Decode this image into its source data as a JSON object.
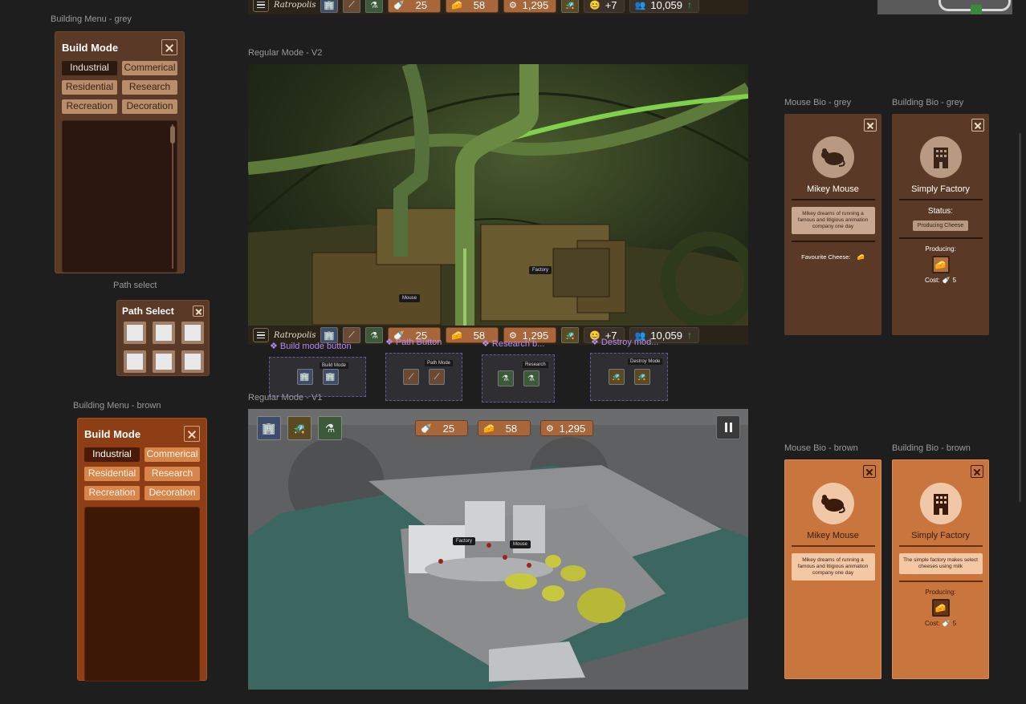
{
  "labels": {
    "building_menu_grey": "Building Menu - grey",
    "path_select": "Path select",
    "building_menu_brown": "Building Menu - brown",
    "regular_v2": "Regular Mode - V2",
    "regular_v1": "Regular Mode - V1",
    "mouse_bio_grey": "Mouse Bio - grey",
    "building_bio_grey": "Building Bio - grey",
    "mouse_bio_brown": "Mouse Bio - brown",
    "building_bio_brown": "Building Bio - brown"
  },
  "build_menu": {
    "title": "Build Mode",
    "categories": [
      "Industrial",
      "Commerical",
      "Residential",
      "Research",
      "Recreation",
      "Decoration"
    ]
  },
  "path_select": {
    "title": "Path Select"
  },
  "hud": {
    "logo": "Ratropolis",
    "milk": "25",
    "cheese": "58",
    "gears": "1,295",
    "happiness": "+7",
    "population": "10,059"
  },
  "scene_tags": {
    "factory": "Factory",
    "mouse": "Mouse"
  },
  "components": {
    "build": "❖ Build mode button",
    "path": "❖ Path Button",
    "research": "❖ Research b...",
    "destroy": "❖ Destroy mod...",
    "build_tip": "Build Mode",
    "path_tip": "Path Mode",
    "research_tip": "Research",
    "destroy_tip": "Destroy Mode"
  },
  "mouse_bio": {
    "name": "Mikey Mouse",
    "desc": "Mikey dreams of running a famous and litigious animation company one day",
    "fav": "Favourite Cheese:"
  },
  "building_bio": {
    "name": "Simply Factory",
    "status_label": "Status:",
    "status": "Producing Cheese",
    "producing": "Producing:",
    "cost_label": "Cost:",
    "cost": "5",
    "desc_brown": "The simple factory makes select cheeses using milk"
  },
  "icons": {
    "close": "close-icon",
    "menu": "hamburger-icon",
    "milk": "milk-bottle-icon",
    "cheese": "cheese-icon",
    "gears": "gear-icon",
    "happiness": "smiley-icon",
    "population": "people-icon",
    "build": "building-add-icon",
    "path": "path-tool-icon",
    "research": "flask-icon",
    "destroy": "bulldozer-icon",
    "pause": "pause-icon",
    "mouse": "mouse-icon",
    "factory": "factory-icon"
  },
  "colors": {
    "grey_panel": "#5a3a26",
    "brown_panel": "#8e3e14",
    "resource_chip": "#a8673a",
    "canvas": "#1e1e1e"
  }
}
